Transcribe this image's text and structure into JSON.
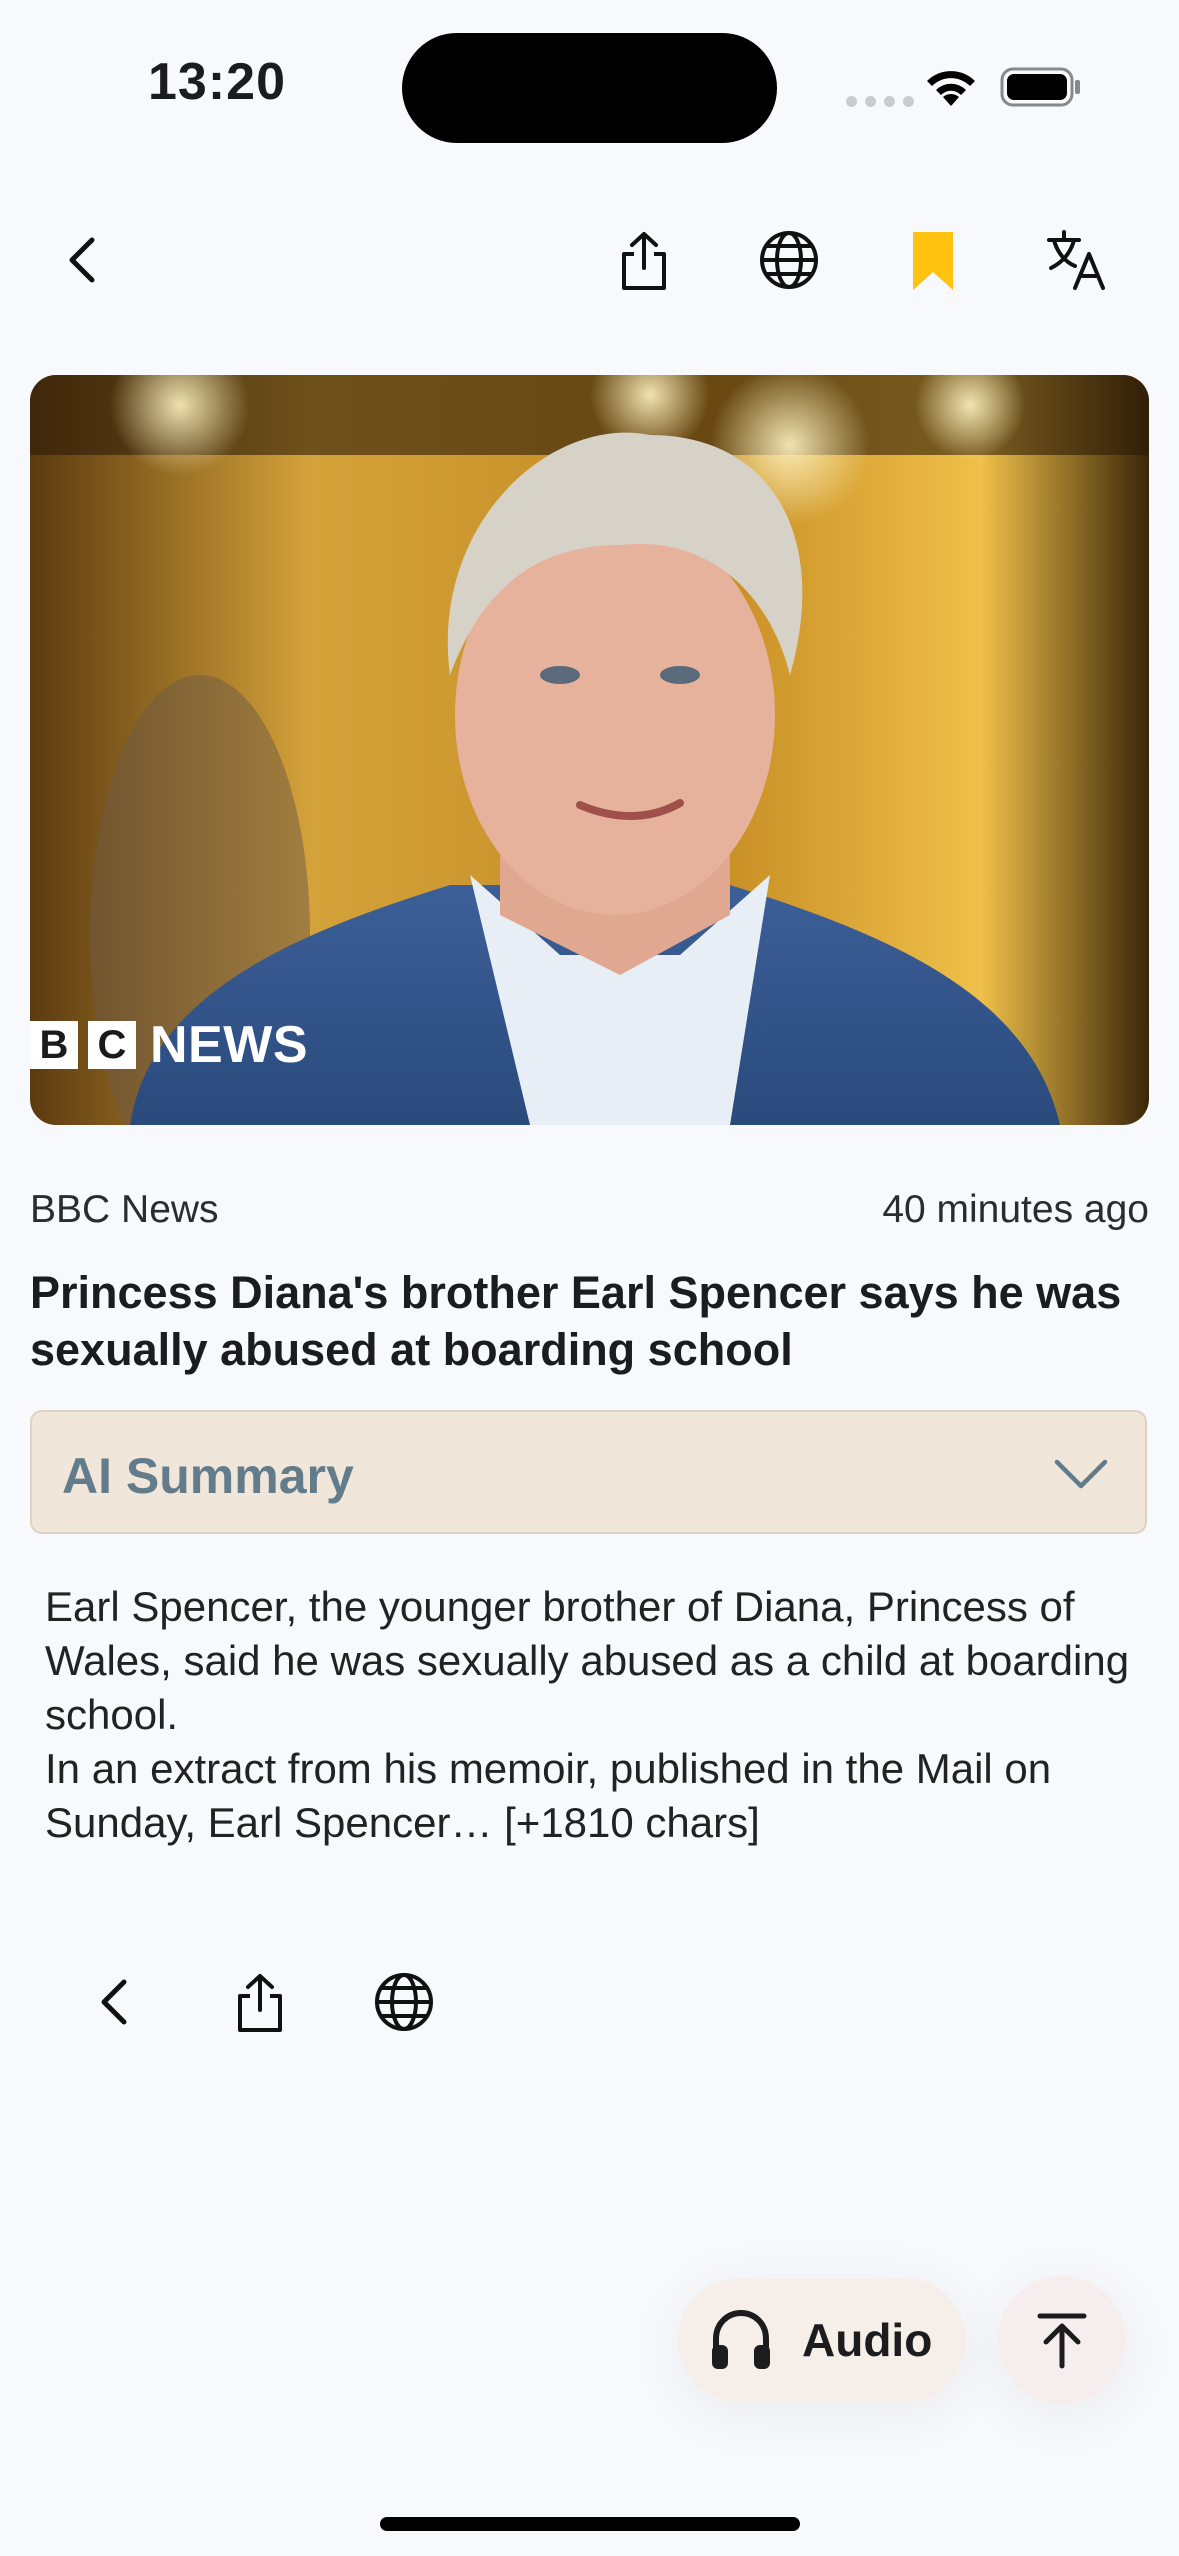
{
  "status_bar": {
    "time": "13:20"
  },
  "nav": {
    "icons": [
      "back-icon",
      "share-icon",
      "globe-icon",
      "bookmark-icon",
      "translate-icon"
    ]
  },
  "hero": {
    "logo_letters": [
      "B",
      "C"
    ],
    "logo_word": "NEWS"
  },
  "article": {
    "source": "BBC News",
    "time_ago": "40 minutes ago",
    "headline": "Princess Diana's brother Earl Spencer says he was sexually abused at boarding school",
    "summary_text": "Earl Spencer, the younger brother of Diana, Princess of Wales, said he was sexually abused as a child at boarding school.\nIn an extract from his memoir, published in the Mail on Sunday, Earl Spencer… [+1810 chars]"
  },
  "ai_summary": {
    "label": "AI Summary"
  },
  "floating": {
    "audio_label": "Audio"
  },
  "colors": {
    "bookmark": "#FFC20E",
    "ai_summary_bg": "#F1E6DA",
    "ai_summary_text": "#627C8C"
  }
}
